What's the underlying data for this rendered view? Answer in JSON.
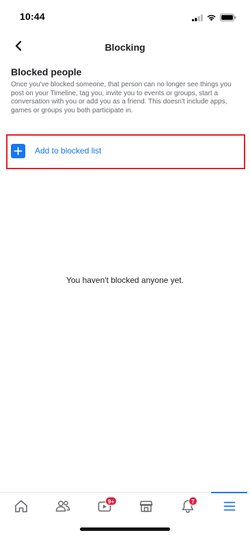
{
  "status_bar": {
    "time": "10:44",
    "icons": [
      "signal-icon",
      "wifi-icon",
      "battery-icon"
    ]
  },
  "header": {
    "title": "Blocking",
    "back_icon": "chevron-left-icon"
  },
  "blocked_people": {
    "title": "Blocked people",
    "description": "Once you've blocked someone, that person can no longer see things you post on your Timeline, tag you, invite you to events or groups, start a conversation with you or add you as a friend. This doesn't include apps, games or groups you both participate in.",
    "add_label": "Add to blocked list",
    "empty_message": "You haven't blocked anyone yet."
  },
  "bottom_nav": {
    "items": [
      {
        "name": "home",
        "icon": "home-icon"
      },
      {
        "name": "friends",
        "icon": "friends-icon"
      },
      {
        "name": "watch",
        "icon": "video-icon",
        "badge": "9+"
      },
      {
        "name": "marketplace",
        "icon": "shop-icon"
      },
      {
        "name": "notifications",
        "icon": "bell-icon",
        "badge": "7"
      },
      {
        "name": "menu",
        "icon": "menu-icon",
        "active": true
      }
    ]
  },
  "colors": {
    "accent": "#1877f2",
    "highlight_border": "#e41e26",
    "badge": "#e41e3f",
    "secondary_text": "#65676b"
  }
}
